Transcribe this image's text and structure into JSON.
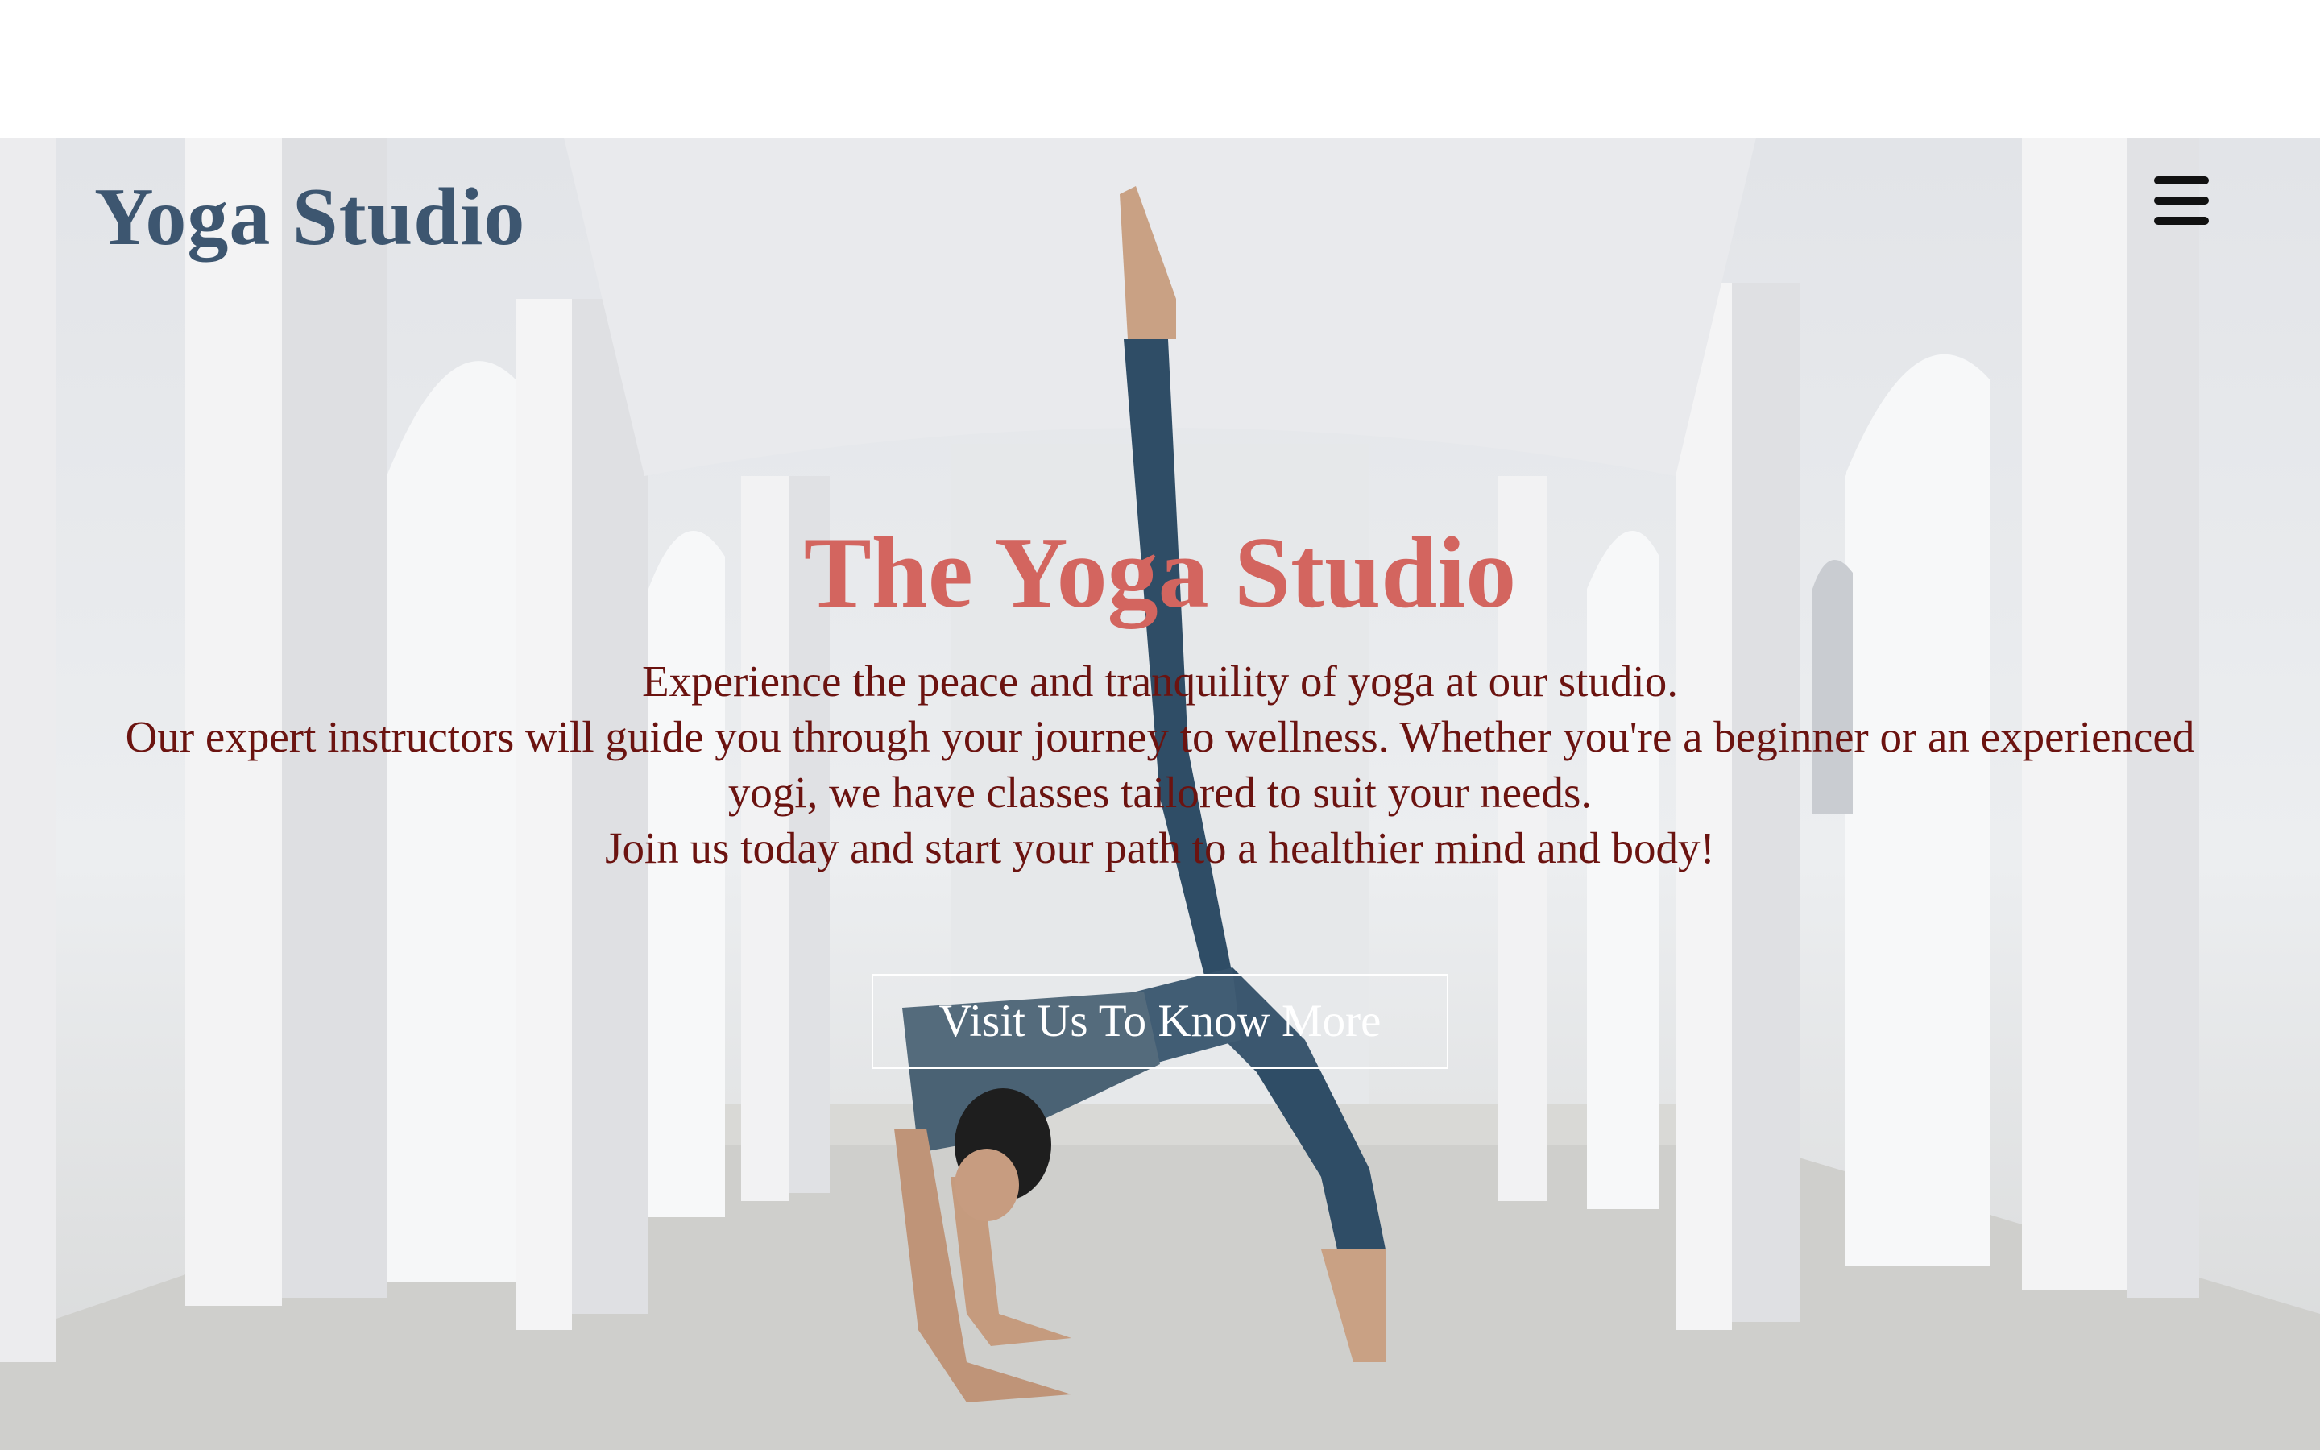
{
  "header": {
    "brand": "Yoga Studio",
    "menu_icon": "hamburger-menu-icon"
  },
  "hero": {
    "background_image": "woman-yoga-pose-arched-corridor-photo",
    "title": "The Yoga Studio",
    "lines": [
      "Experience the peace and tranquility of yoga at our studio.",
      "Our expert instructors will guide you through your journey to wellness. Whether you're a beginner or an experienced yogi, we have classes tailored to suit your needs.",
      "Join us today and start your path to a healthier mind and body!"
    ],
    "cta_label": "Visit Us To Know More"
  },
  "colors": {
    "brand": "#3d5670",
    "title": "#d3655f",
    "body_text": "#6b1310",
    "cta_text": "#ffffff"
  }
}
